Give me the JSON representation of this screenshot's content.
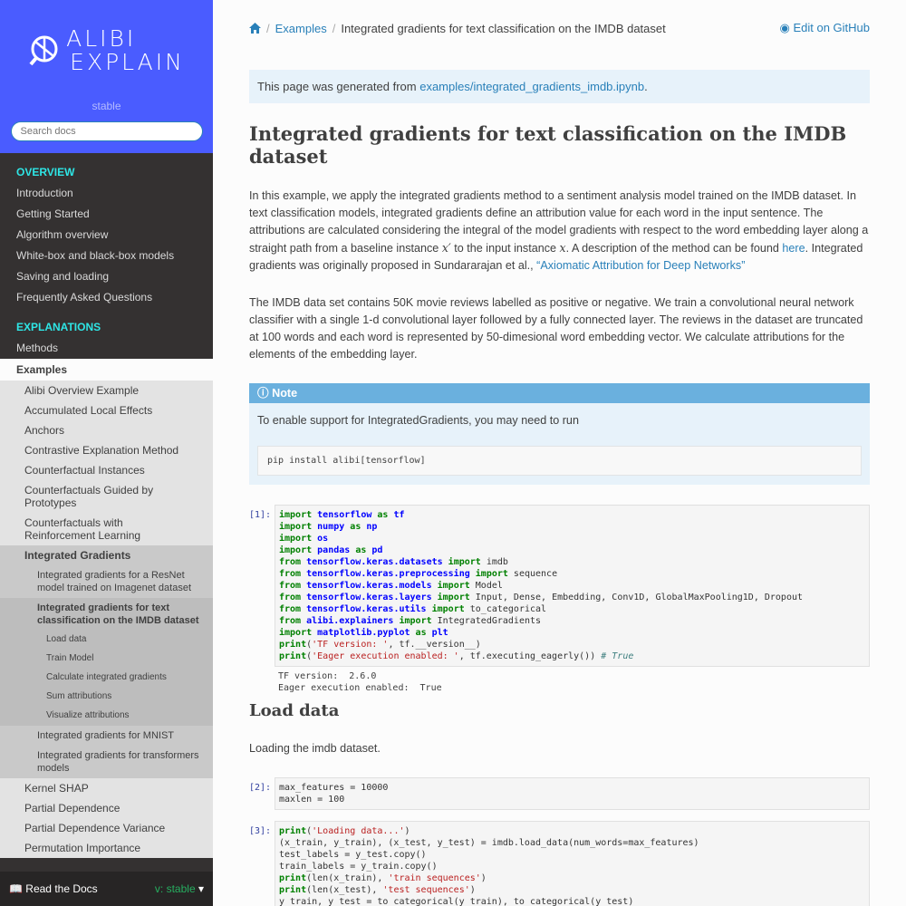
{
  "sidebar": {
    "logo_line1": "ALIBI",
    "logo_line2": "EXPLAIN",
    "version": "stable",
    "search_placeholder": "Search docs",
    "caption_overview": "OVERVIEW",
    "overview_items": [
      "Introduction",
      "Getting Started",
      "Algorithm overview",
      "White-box and black-box models",
      "Saving and loading",
      "Frequently Asked Questions"
    ],
    "caption_explanations": "EXPLANATIONS",
    "methods": "Methods",
    "examples": "Examples",
    "examples_items": [
      "Alibi Overview Example",
      "Accumulated Local Effects",
      "Anchors",
      "Contrastive Explanation Method",
      "Counterfactual Instances",
      "Counterfactuals Guided by Prototypes",
      "Counterfactuals with Reinforcement Learning"
    ],
    "ig": "Integrated Gradients",
    "ig_sub1": "Integrated gradients for a ResNet model trained on Imagenet dataset",
    "ig_sub2": "Integrated gradients for text classification on the IMDB dataset",
    "ig_sub2_items": [
      "Load data",
      "Train Model",
      "Calculate integrated gradients",
      "Sum attributions",
      "Visualize attributions"
    ],
    "ig_sub3": "Integrated gradients for MNIST",
    "ig_sub4": "Integrated gradients for transformers models",
    "after_items": [
      "Kernel SHAP",
      "Partial Dependence",
      "Partial Dependence Variance",
      "Permutation Importance"
    ],
    "rtd_label": "Read the Docs",
    "rtd_version": "v: stable"
  },
  "breadcrumb": {
    "examples": "Examples",
    "current": "Integrated gradients for text classification on the IMDB dataset",
    "edit": "Edit on GitHub"
  },
  "generated": {
    "prefix": "This page was generated from ",
    "link": "examples/integrated_gradients_imdb.ipynb",
    "suffix": "."
  },
  "title": "Integrated gradients for text classification on the IMDB dataset",
  "para1": {
    "a": "In this example, we apply the integrated gradients method to a sentiment analysis model trained on the IMDB dataset. In text classification models, integrated gradients define an attribution value for each word in the input sentence. The attributions are calculated considering the integral of the model gradients with respect to the word embedding layer along a straight path from a baseline instance ",
    "x1": "x′",
    "b": " to the input instance ",
    "x2": "x",
    "c": ". A description of the method can be found ",
    "here": "here",
    "d": ". Integrated gradients was originally proposed in Sundararajan et al., ",
    "link": "“Axiomatic Attribution for Deep Networks”"
  },
  "para2": "The IMDB data set contains 50K movie reviews labelled as positive or negative. We train a convolutional neural network classifier with a single 1-d convolutional layer followed by a fully connected layer. The reviews in the dataset are truncated at 100 words and each word is represented by 50-dimesional word embedding vector. We calculate attributions for the elements of the embedding layer.",
  "note": {
    "title": "Note",
    "text": "To enable support for IntegratedGradients, you may need to run",
    "cmd": "pip install alibi[tensorflow]"
  },
  "cell1": {
    "prompt": "[1]:",
    "output": "TF version:  2.6.0\nEager execution enabled:  True"
  },
  "h_load": "Load data",
  "load_text": "Loading the imdb dataset.",
  "cell2": {
    "prompt": "[2]:",
    "code": "max_features = 10000\nmaxlen = 100"
  },
  "cell3": {
    "prompt": "[3]:"
  }
}
